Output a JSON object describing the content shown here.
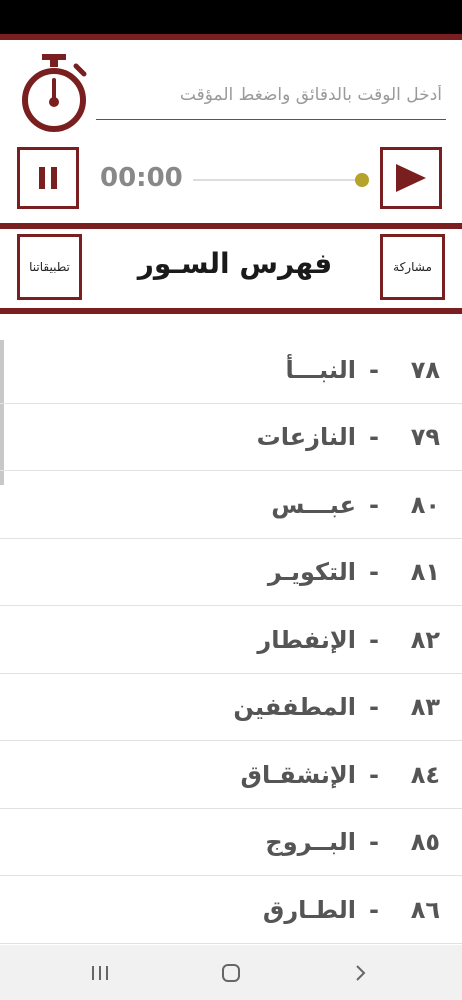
{
  "timer": {
    "placeholder": "أدخل الوقت بالدقائق واضغط المؤقت",
    "icon": "stopwatch-icon"
  },
  "player": {
    "time": "00:00",
    "pause_icon": "pause-icon",
    "play_icon": "play-icon",
    "accent": "#7a1f1f",
    "seek_color": "#b5a32a"
  },
  "header": {
    "title": "فهرس السـور",
    "share_label": "مشاركة",
    "apps_label": "تطبيقاتنا"
  },
  "surahs": [
    {
      "num": "٧٨",
      "dash": "-",
      "name": "النبـــأ"
    },
    {
      "num": "٧٩",
      "dash": "-",
      "name": "النازعات"
    },
    {
      "num": "٨٠",
      "dash": "-",
      "name": "عبـــس"
    },
    {
      "num": "٨١",
      "dash": "-",
      "name": "التكويـر"
    },
    {
      "num": "٨٢",
      "dash": "-",
      "name": "الإنفطار"
    },
    {
      "num": "٨٣",
      "dash": "-",
      "name": "المطففين"
    },
    {
      "num": "٨٤",
      "dash": "-",
      "name": "الإنشقـاق"
    },
    {
      "num": "٨٥",
      "dash": "-",
      "name": "البــروج"
    },
    {
      "num": "٨٦",
      "dash": "-",
      "name": "الطـارق"
    }
  ],
  "nav": {
    "recents_icon": "recents-icon",
    "home_icon": "home-icon",
    "back_icon": "back-icon"
  }
}
